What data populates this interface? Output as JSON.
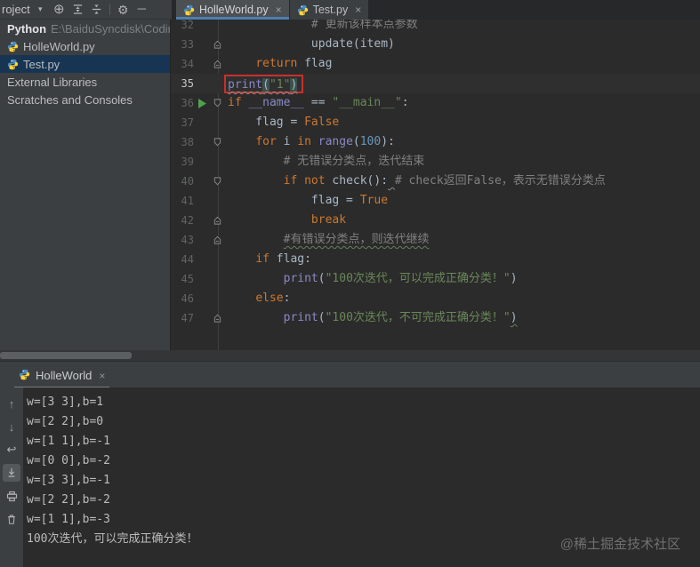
{
  "palette": {
    "editor_bg": "#2b2b2b",
    "panel_bg": "#3c3f41",
    "tab_underline": "#4c7fb2",
    "selection_blue": "#173453",
    "keyword_orange": "#cc7832",
    "builtin_purple": "#8888c6",
    "string_green": "#6a8759",
    "number_blue": "#6897bb",
    "comment_gray": "#808080",
    "annotation_red": "#c9302c",
    "run_green": "#4ea24e"
  },
  "project_toolbar": {
    "title": "roject",
    "icons": [
      "caret-down",
      "locate",
      "expand-all",
      "collapse-all",
      "divider",
      "settings",
      "minimize"
    ]
  },
  "editor_tabs": [
    {
      "label": "HolleWorld.py",
      "icon": "python",
      "active": true,
      "close": "×"
    },
    {
      "label": "Test.py",
      "icon": "python",
      "active": false,
      "close": "×"
    }
  ],
  "project_tree": {
    "root": {
      "name": "Python",
      "path": "E:\\BaiduSyncdisk\\Codin"
    },
    "items": [
      {
        "label": "HolleWorld.py",
        "icon": "python",
        "selected": false
      },
      {
        "label": "Test.py",
        "icon": "python",
        "selected": true
      },
      {
        "label": "External Libraries",
        "icon": null,
        "selected": false
      },
      {
        "label": "Scratches and Consoles",
        "icon": null,
        "selected": false
      }
    ]
  },
  "editor": {
    "lines": [
      {
        "n": 32,
        "fold": null,
        "run": false,
        "current": false,
        "boxed": false,
        "tokens": [
          [
            "            ",
            "txt"
          ],
          [
            "# 更新该样本点参数",
            "com"
          ]
        ]
      },
      {
        "n": 33,
        "fold": "up",
        "run": false,
        "current": false,
        "boxed": false,
        "tokens": [
          [
            "            ",
            "txt"
          ],
          [
            "update(item)",
            "txt"
          ]
        ]
      },
      {
        "n": 34,
        "fold": "up",
        "run": false,
        "current": false,
        "boxed": false,
        "tokens": [
          [
            "    ",
            "txt"
          ],
          [
            "return",
            "kw"
          ],
          [
            " flag",
            "txt"
          ]
        ]
      },
      {
        "n": 35,
        "fold": null,
        "run": false,
        "current": true,
        "boxed": true,
        "tokens": [
          [
            "print",
            "fn u-wavy"
          ],
          [
            "(",
            "txt hl u-wavy"
          ],
          [
            "\"1\"",
            "str u-wavy"
          ],
          [
            ")",
            "txt hl u-wavy"
          ]
        ]
      },
      {
        "n": 36,
        "fold": "down",
        "run": true,
        "current": false,
        "boxed": false,
        "tokens": [
          [
            "if",
            "kw"
          ],
          [
            " ",
            "txt"
          ],
          [
            "__name__",
            "fn"
          ],
          [
            " == ",
            "txt"
          ],
          [
            "\"__main__\"",
            "str"
          ],
          [
            ":",
            "txt"
          ]
        ]
      },
      {
        "n": 37,
        "fold": null,
        "run": false,
        "current": false,
        "boxed": false,
        "tokens": [
          [
            "    flag = ",
            "txt"
          ],
          [
            "False",
            "kw"
          ]
        ]
      },
      {
        "n": 38,
        "fold": "down",
        "run": false,
        "current": false,
        "boxed": false,
        "tokens": [
          [
            "    ",
            "txt"
          ],
          [
            "for",
            "kw"
          ],
          [
            " i ",
            "txt"
          ],
          [
            "in",
            "kw"
          ],
          [
            " ",
            "txt"
          ],
          [
            "range",
            "fn"
          ],
          [
            "(",
            "txt"
          ],
          [
            "100",
            "num"
          ],
          [
            "):",
            "txt"
          ]
        ]
      },
      {
        "n": 39,
        "fold": null,
        "run": false,
        "current": false,
        "boxed": false,
        "tokens": [
          [
            "        ",
            "txt"
          ],
          [
            "# 无错误分类点，迭代结束",
            "com"
          ]
        ]
      },
      {
        "n": 40,
        "fold": "down",
        "run": false,
        "current": false,
        "boxed": false,
        "tokens": [
          [
            "        ",
            "txt"
          ],
          [
            "if",
            "kw"
          ],
          [
            " ",
            "txt"
          ],
          [
            "not",
            "kw"
          ],
          [
            " check():",
            "txt"
          ],
          [
            " ",
            "txt u-wavy"
          ],
          [
            "# check返回False，表示无错误分类点",
            "com"
          ]
        ]
      },
      {
        "n": 41,
        "fold": null,
        "run": false,
        "current": false,
        "boxed": false,
        "tokens": [
          [
            "            flag = ",
            "txt"
          ],
          [
            "True",
            "kw"
          ]
        ]
      },
      {
        "n": 42,
        "fold": "up",
        "run": false,
        "current": false,
        "boxed": false,
        "tokens": [
          [
            "            ",
            "txt"
          ],
          [
            "break",
            "kw"
          ]
        ]
      },
      {
        "n": 43,
        "fold": "up",
        "run": false,
        "current": false,
        "boxed": false,
        "tokens": [
          [
            "        ",
            "txt"
          ],
          [
            "#有错误分类点，则迭代继续",
            "com u-wavy-green"
          ]
        ]
      },
      {
        "n": 44,
        "fold": null,
        "run": false,
        "current": false,
        "boxed": false,
        "tokens": [
          [
            "    ",
            "txt"
          ],
          [
            "if",
            "kw"
          ],
          [
            " flag:",
            "txt"
          ]
        ]
      },
      {
        "n": 45,
        "fold": null,
        "run": false,
        "current": false,
        "boxed": false,
        "tokens": [
          [
            "        ",
            "txt"
          ],
          [
            "print",
            "fn"
          ],
          [
            "(",
            "txt"
          ],
          [
            "\"100次迭代，可以完成正确分类！\"",
            "str"
          ],
          [
            ")",
            "txt"
          ]
        ]
      },
      {
        "n": 46,
        "fold": null,
        "run": false,
        "current": false,
        "boxed": false,
        "tokens": [
          [
            "    ",
            "txt"
          ],
          [
            "else",
            "kw"
          ],
          [
            ":",
            "txt"
          ]
        ]
      },
      {
        "n": 47,
        "fold": "up",
        "run": false,
        "current": false,
        "boxed": false,
        "tokens": [
          [
            "        ",
            "txt"
          ],
          [
            "print",
            "fn"
          ],
          [
            "(",
            "txt"
          ],
          [
            "\"100次迭代，不可完成正确分类！\"",
            "str"
          ],
          [
            ")",
            "txt u-wavy-green"
          ]
        ]
      }
    ]
  },
  "console": {
    "tab": {
      "label": "HolleWorld",
      "icon": "python",
      "close": "×"
    },
    "stripe_icons": [
      "arrow-up",
      "arrow-down",
      "soft-wrap",
      "scroll-end",
      "printer",
      "trash"
    ],
    "selected_icon": "scroll-end",
    "lines": [
      "w=[3 3],b=1",
      "w=[2 2],b=0",
      "w=[1 1],b=-1",
      "w=[0 0],b=-2",
      "w=[3 3],b=-1",
      "w=[2 2],b=-2",
      "w=[1 1],b=-3",
      "100次迭代，可以完成正确分类！"
    ]
  },
  "watermark": "@稀土掘金技术社区"
}
